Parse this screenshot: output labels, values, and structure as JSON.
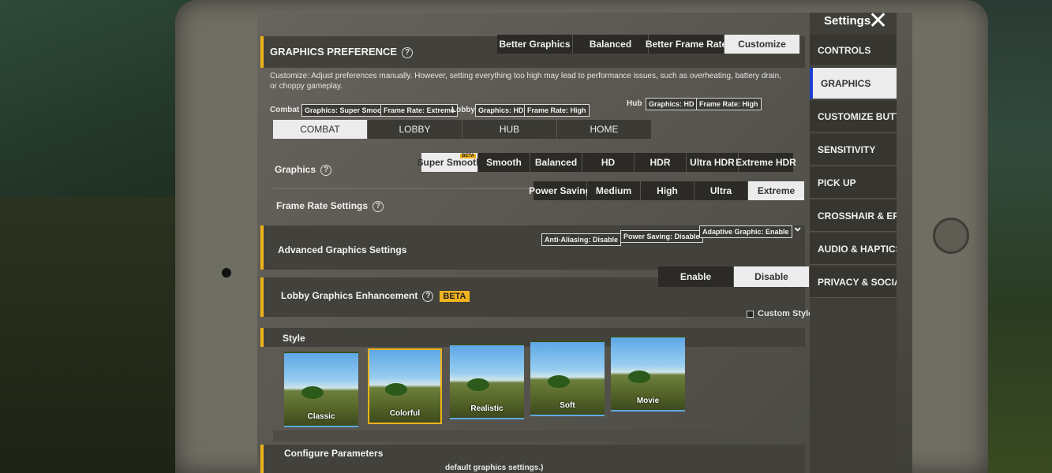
{
  "header": {
    "title": "GRAPHICS PREFERENCE",
    "presets": [
      "Better Graphics",
      "Balanced",
      "Better Frame Rate",
      "Customize"
    ],
    "selected_preset": "Customize",
    "description": "Customize: Adjust preferences manually. However, setting everything too high may lead to performance issues, such as overheating, battery drain, or choppy gameplay.",
    "summary": {
      "combat_label": "Combat",
      "combat_graphics": "Graphics: Super Smooth",
      "combat_frame_rate": "Frame Rate: Extreme",
      "lobby_label": "Lobby",
      "lobby_graphics": "Graphics: HD",
      "lobby_frame_rate": "Frame Rate: High",
      "hub_label": "Hub",
      "hub_graphics": "Graphics: HD",
      "hub_frame_rate": "Frame Rate: High"
    }
  },
  "tabs": [
    "COMBAT",
    "LOBBY",
    "HUB",
    "HOME"
  ],
  "selected_tab": "COMBAT",
  "graphics": {
    "label": "Graphics",
    "options": [
      "Super Smooth",
      "Smooth",
      "Balanced",
      "HD",
      "HDR",
      "Ultra HDR",
      "Extreme HDR"
    ],
    "selected": "Super Smooth",
    "beta_tag": "BETA"
  },
  "frame_rate": {
    "label": "Frame Rate Settings",
    "options": [
      "Power Saving",
      "Medium",
      "High",
      "Ultra",
      "Extreme"
    ],
    "selected": "Extreme"
  },
  "advanced": {
    "label": "Advanced Graphics Settings",
    "chips": [
      "Anti-Aliasing: Disable",
      "Power Saving: Disable",
      "Adaptive Graphic: Enable"
    ]
  },
  "lobby_enhancement": {
    "label": "Lobby Graphics Enhancement",
    "beta": "BETA",
    "options": [
      "Enable",
      "Disable"
    ],
    "selected": "Disable"
  },
  "style": {
    "label": "Style",
    "custom_style": "Custom Style",
    "items": [
      "Classic",
      "Colorful",
      "Realistic",
      "Soft",
      "Movie"
    ],
    "selected": "Colorful"
  },
  "configure": {
    "label": "Configure Parameters",
    "partial_text": "default graphics settings.)"
  },
  "sidebar": {
    "title": "Settings",
    "items": [
      "CONTROLS",
      "GRAPHICS",
      "CUSTOMIZE BUTTONS",
      "SENSITIVITY",
      "PICK UP",
      "CROSSHAIR & EFFECT",
      "AUDIO & HAPTICS",
      "PRIVACY & SOCIAL"
    ],
    "selected": "GRAPHICS"
  },
  "colors": {
    "accent": "#f0b21c",
    "selected_bg": "#ececec",
    "option_bg": "#2b2a26",
    "sidebar_selected_edge": "#1e3fd1"
  }
}
